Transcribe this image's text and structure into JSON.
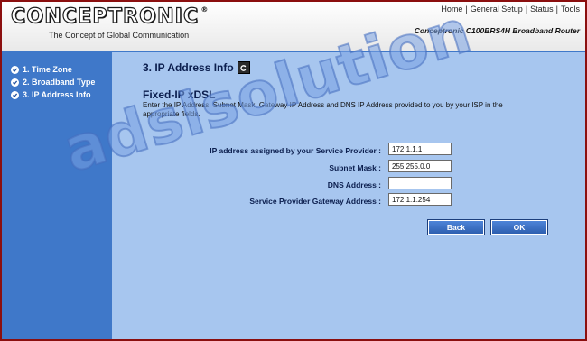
{
  "header": {
    "logo_text": "CONCEPTRONIC",
    "logo_mark": "®",
    "tagline": "The Concept of Global Communication",
    "nav": [
      {
        "label": "Home"
      },
      {
        "label": "General Setup"
      },
      {
        "label": "Status"
      },
      {
        "label": "Tools"
      }
    ],
    "nav_separator": "|",
    "product_name": "Conceptronic C100BRS4H Broadband Router"
  },
  "sidebar": {
    "steps": [
      {
        "label": "1. Time Zone",
        "icon": "checkmark-icon"
      },
      {
        "label": "2. Broadband Type",
        "icon": "checkmark-icon"
      },
      {
        "label": "3. IP Address Info",
        "icon": "checkmark-icon"
      }
    ]
  },
  "main": {
    "title": "3. IP Address Info",
    "help_icon": "help-icon",
    "subtitle": "Fixed-IP xDSL",
    "description": "Enter the IP Address, Subnet Mask, Gateway IP Address and DNS IP Address provided to you by your ISP in the appropriate fields.",
    "fields": [
      {
        "label": "IP address assigned by your Service Provider :",
        "value": "172.1.1.1"
      },
      {
        "label": "Subnet Mask :",
        "value": "255.255.0.0"
      },
      {
        "label": "DNS Address :",
        "value": ""
      },
      {
        "label": "Service Provider Gateway Address :",
        "value": "172.1.1.254"
      }
    ],
    "back_label": "Back",
    "ok_label": "OK"
  },
  "watermark": "adslsolution",
  "colors": {
    "border": "#8b0f0f",
    "sidebar": "#3f78c9",
    "content": "#a7c6ef",
    "heading": "#0b1e4e"
  }
}
